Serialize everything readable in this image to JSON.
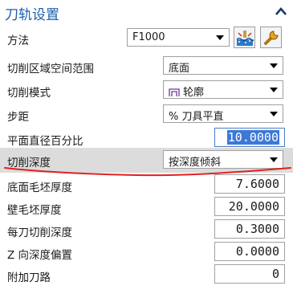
{
  "section": {
    "title": "刀轨设置",
    "collapse_icon": "chevron-up-icon"
  },
  "rows": {
    "method": {
      "label": "方法",
      "value": "F1000"
    },
    "cut_region": {
      "label": "切削区域空间范围",
      "value": "底面"
    },
    "cut_mode": {
      "label": "切削模式",
      "value": "轮廓",
      "icon": "contour-pattern-icon"
    },
    "stepover": {
      "label": "步距",
      "value": "% 刀具平直"
    },
    "flat_diameter_pct": {
      "label": "平面直径百分比",
      "value": "10.0000"
    },
    "cut_depth": {
      "label": "切削深度",
      "value": "按深度倾斜"
    },
    "floor_stock": {
      "label": "底面毛坯厚度",
      "value": "7.6000"
    },
    "wall_stock": {
      "label": "壁毛坯厚度",
      "value": "20.0000"
    },
    "depth_per_cut": {
      "label": "每刀切削深度",
      "value": "0.3000"
    },
    "z_depth_offset": {
      "label": "Z 向深度偏置",
      "value": "0.0000"
    },
    "additional_passes": {
      "label": "附加刀路",
      "value": "0"
    }
  },
  "buttons": {
    "method_display": {
      "icon": "method-display-icon"
    },
    "method_edit": {
      "icon": "wrench-icon"
    }
  },
  "annotation_color": "#e02020"
}
